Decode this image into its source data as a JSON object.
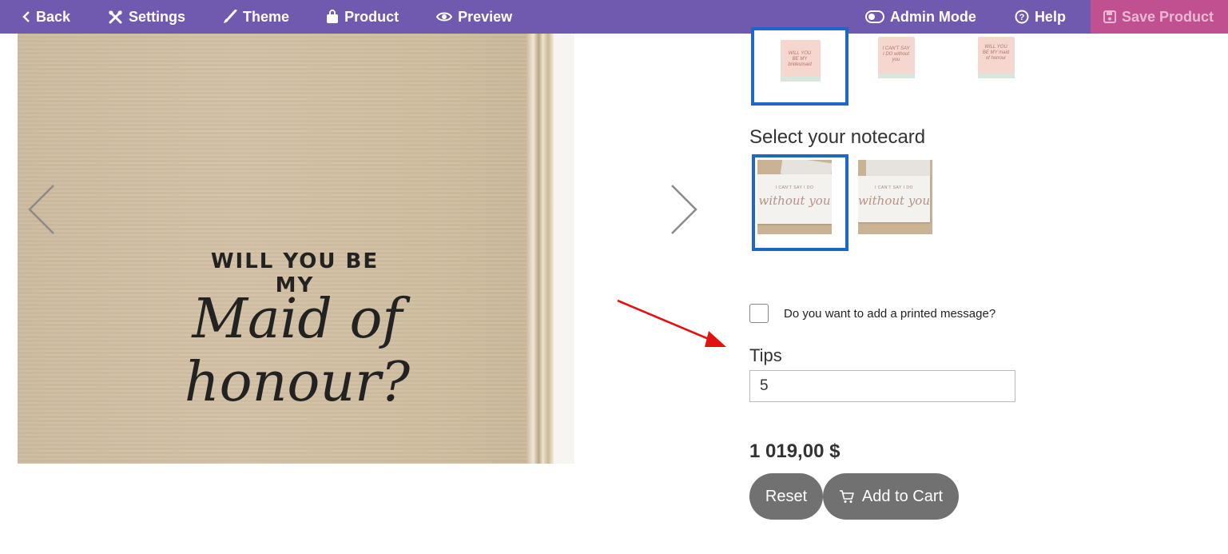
{
  "toolbar": {
    "back_label": "Back",
    "settings_label": "Settings",
    "theme_label": "Theme",
    "product_label": "Product",
    "preview_label": "Preview",
    "admin_mode_label": "Admin Mode",
    "help_label": "Help",
    "save_label": "Save Product",
    "background_color": "#6f5aaf",
    "save_background_color": "#c0508f"
  },
  "product_image": {
    "engraving_line1": "WILL YOU BE MY",
    "engraving_line2": "Maid of honour?"
  },
  "candle_thumbnails": [
    {
      "label": "WILL YOU BE MY bridesmaid",
      "selected": true
    },
    {
      "label": "I CAN'T SAY I DO without you",
      "selected": false
    },
    {
      "label": "WILL YOU BE MY maid of honour",
      "selected": false
    }
  ],
  "notecard_section": {
    "heading": "Select your notecard",
    "cards": [
      {
        "small_text": "I CAN'T SAY I DO",
        "script_text": "without you",
        "selected": true
      },
      {
        "small_text": "I CAN'T SAY I DO",
        "script_text": "without you",
        "selected": false
      }
    ]
  },
  "printed_message": {
    "label": "Do you want to add a printed message?",
    "checked": false
  },
  "tips": {
    "heading": "Tips",
    "value": "5"
  },
  "price": "1 019,00 $",
  "buttons": {
    "reset_label": "Reset",
    "add_to_cart_label": "Add to Cart",
    "button_color": "#717171"
  },
  "colors": {
    "selection_border": "#1e66c8",
    "annotation_arrow": "#e31212"
  }
}
